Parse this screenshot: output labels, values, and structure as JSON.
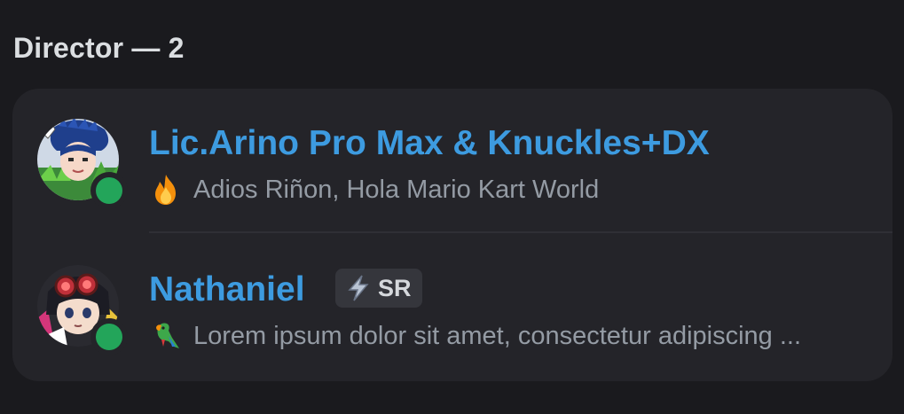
{
  "section": {
    "title": "Director — 2"
  },
  "members": [
    {
      "name": "Lic.Arino Pro Max & Knuckles+DX",
      "status_emoji": "fire-emoji",
      "status_text": "Adios Riñon, Hola Mario Kart World",
      "presence": "online",
      "name_color": "#3d9be0"
    },
    {
      "name": "Nathaniel",
      "tag": "SR",
      "tag_icon": "lightning-icon",
      "status_emoji": "parrot-emoji",
      "status_text": "Lorem ipsum dolor sit amet, consectetur adipiscing ...",
      "presence": "online",
      "name_color": "#3d9be0"
    }
  ],
  "colors": {
    "background": "#1a1a1e",
    "card": "#242429",
    "online": "#23a55a",
    "secondary_text": "#949ba4"
  }
}
